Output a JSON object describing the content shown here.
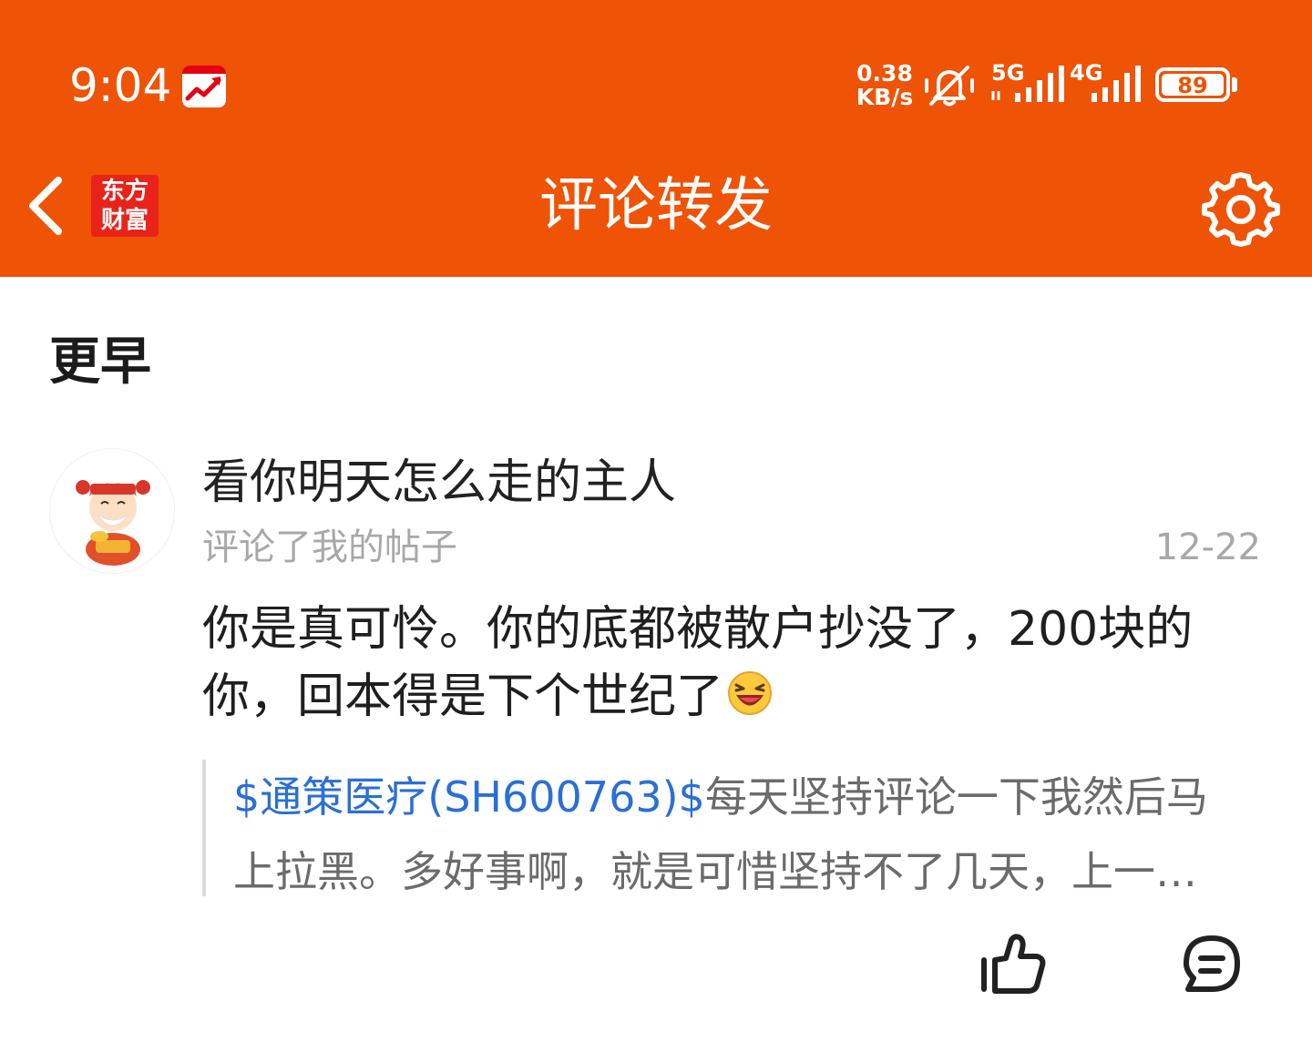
{
  "status_bar": {
    "time": "9:04",
    "net_speed_value": "0.38",
    "net_speed_unit": "KB/s",
    "network_1": "5G",
    "network_2": "4G",
    "battery": "89"
  },
  "header": {
    "brand_line1": "东方",
    "brand_line2": "财富",
    "title": "评论转发",
    "background_color": "#ee5306"
  },
  "section": {
    "title": "更早"
  },
  "notification": {
    "username": "看你明天怎么走的主人",
    "action": "评论了我的帖子",
    "date": "12-22",
    "comment": "你是真可怜。你的底都被散户抄没了，200块的你，回本得是下个世纪了",
    "quote": {
      "stock_link": "$通策医疗(SH600763)$",
      "line1_rest": "每天坚持评论一下我然后马",
      "line2": "上拉黑。多好事啊，就是可惜坚持不了几天，上一…"
    }
  },
  "icons": {
    "back": "back-arrow-icon",
    "settings": "gear-icon",
    "like": "thumbs-up-icon",
    "reply": "comment-icon",
    "emoji": "laughing-emoji"
  }
}
